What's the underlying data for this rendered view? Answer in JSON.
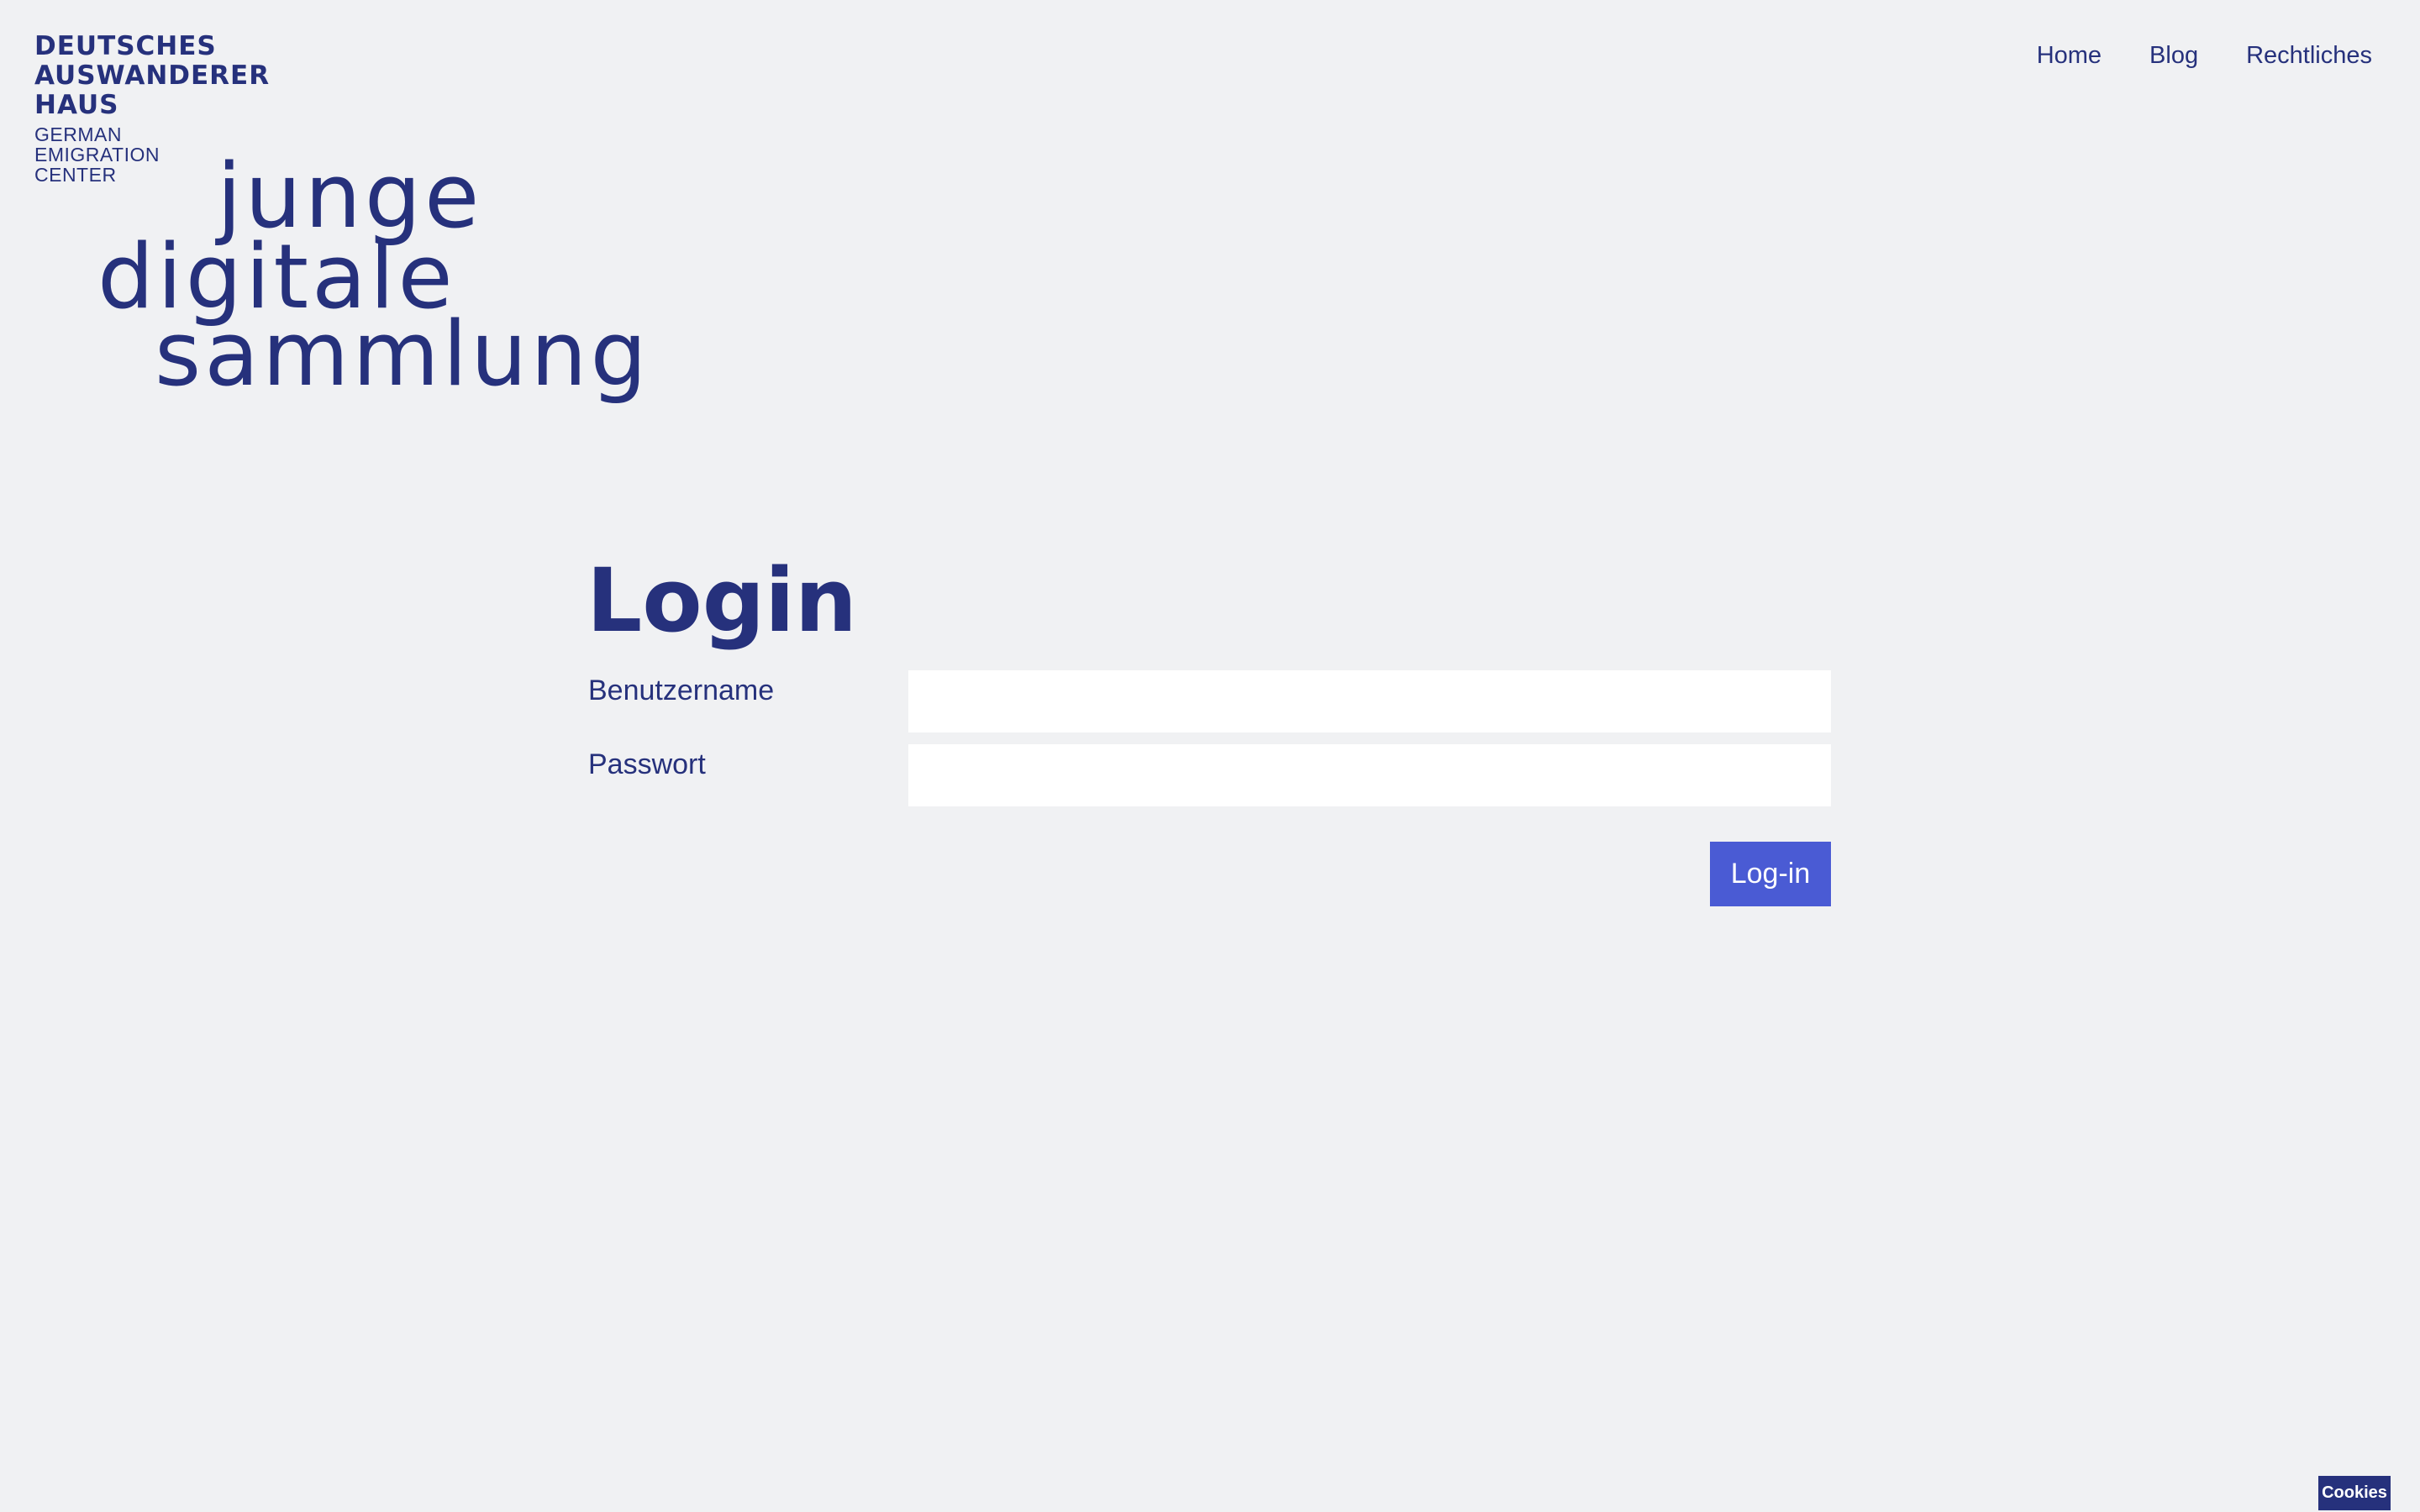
{
  "logo": {
    "lines": [
      "DEUTSCHES",
      "AUSWANDERER",
      "HAUS"
    ],
    "sub_lines": [
      "GERMAN",
      "EMIGRATION",
      "CENTER"
    ]
  },
  "nav": {
    "items": [
      {
        "label": "Home"
      },
      {
        "label": "Blog"
      },
      {
        "label": "Rechtliches"
      }
    ]
  },
  "wordmark": {
    "lines": [
      "junge",
      "digitale",
      "sammlung"
    ]
  },
  "login": {
    "title": "Login",
    "username_label": "Benutzername",
    "username_value": "",
    "password_label": "Passwort",
    "password_value": "",
    "submit_label": "Log-in"
  },
  "cookies": {
    "label": "Cookies"
  },
  "colors": {
    "background": "#f0f1f3",
    "brand": "#26317c",
    "button": "#4a5bd4",
    "input_background": "#ffffff"
  }
}
